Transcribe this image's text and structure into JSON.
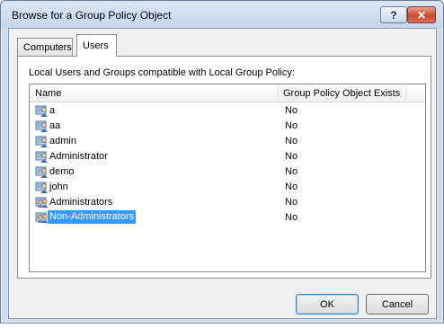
{
  "window": {
    "title": "Browse for a Group Policy Object",
    "help_label": "?",
    "close_label": "✕"
  },
  "tabs": [
    {
      "label": "Computers",
      "selected": false
    },
    {
      "label": "Users",
      "selected": true
    }
  ],
  "panel": {
    "description": "Local Users and Groups compatible with Local Group Policy:"
  },
  "list": {
    "columns": [
      "Name",
      "Group Policy Object Exists"
    ],
    "rows": [
      {
        "name": "a",
        "gpo_exists": "No",
        "icon": "user-icon",
        "selected": false
      },
      {
        "name": "aa",
        "gpo_exists": "No",
        "icon": "user-icon",
        "selected": false
      },
      {
        "name": "admin",
        "gpo_exists": "No",
        "icon": "user-icon",
        "selected": false
      },
      {
        "name": "Administrator",
        "gpo_exists": "No",
        "icon": "user-icon",
        "selected": false
      },
      {
        "name": "demo",
        "gpo_exists": "No",
        "icon": "user-icon",
        "selected": false
      },
      {
        "name": "john",
        "gpo_exists": "No",
        "icon": "user-icon",
        "selected": false
      },
      {
        "name": "Administrators",
        "gpo_exists": "No",
        "icon": "group-icon",
        "selected": false
      },
      {
        "name": "Non-Administrators",
        "gpo_exists": "No",
        "icon": "group-icon",
        "selected": true
      }
    ]
  },
  "buttons": {
    "ok_label": "OK",
    "cancel_label": "Cancel"
  },
  "colors": {
    "selection": "#3399ff",
    "close_button": "#c8472d"
  }
}
